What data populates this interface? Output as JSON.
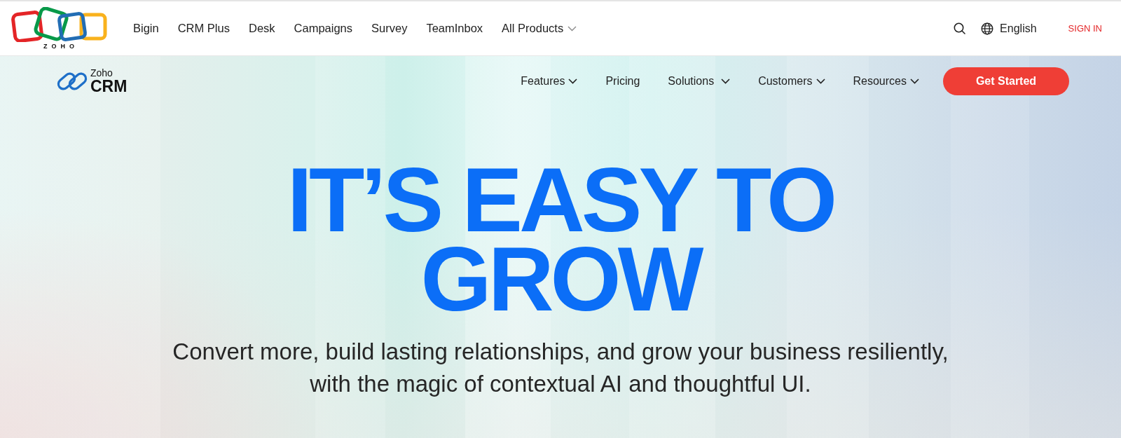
{
  "top_bar": {
    "logo_text": "ZOHO",
    "products": [
      {
        "label": "Bigin",
        "dropdown": false
      },
      {
        "label": "CRM Plus",
        "dropdown": false
      },
      {
        "label": "Desk",
        "dropdown": false
      },
      {
        "label": "Campaigns",
        "dropdown": false
      },
      {
        "label": "Survey",
        "dropdown": false
      },
      {
        "label": "TeamInbox",
        "dropdown": false
      },
      {
        "label": "All Products",
        "dropdown": true
      }
    ],
    "language": "English",
    "sign_in": "SIGN IN"
  },
  "product_nav": {
    "logo": {
      "brand": "Zoho",
      "product": "CRM"
    },
    "items": [
      {
        "label": "Features",
        "dropdown": true
      },
      {
        "label": "Pricing",
        "dropdown": false
      },
      {
        "label": "Solutions",
        "dropdown": true
      },
      {
        "label": "Customers",
        "dropdown": true
      },
      {
        "label": "Resources",
        "dropdown": true
      }
    ],
    "cta": "Get Started"
  },
  "hero": {
    "headline": "IT’S EASY TO GROW",
    "subtitle": "Convert more, build lasting relationships, and grow your business resiliently, with the magic of contextual AI and thoughtful UI."
  }
}
